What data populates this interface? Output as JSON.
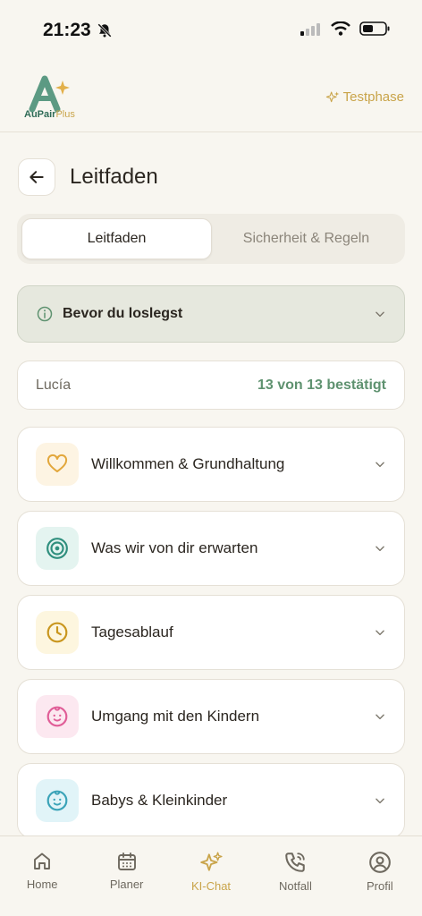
{
  "status": {
    "time": "21:23"
  },
  "header": {
    "logo_text_main": "AuPair",
    "logo_text_accent": "Plus",
    "trial_label": "Testphase"
  },
  "page": {
    "title": "Leitfaden"
  },
  "tabs": [
    {
      "label": "Leitfaden",
      "active": true
    },
    {
      "label": "Sicherheit & Regeln",
      "active": false
    }
  ],
  "notice": {
    "label": "Bevor du loslegst"
  },
  "progress": {
    "name": "Lucía",
    "status": "13 von 13 bestätigt"
  },
  "sections": [
    {
      "label": "Willkommen & Grundhaltung",
      "icon": "heart-icon",
      "color": "#e2a73c",
      "bg": "#fdf4e3"
    },
    {
      "label": "Was wir von dir erwarten",
      "icon": "target-icon",
      "color": "#2f8f7e",
      "bg": "#e4f4f0"
    },
    {
      "label": "Tagesablauf",
      "icon": "clock-icon",
      "color": "#c9961e",
      "bg": "#fdf6df"
    },
    {
      "label": "Umgang mit den Kindern",
      "icon": "baby-icon",
      "color": "#e05d97",
      "bg": "#fce8f0"
    },
    {
      "label": "Babys & Kleinkinder",
      "icon": "baby-icon",
      "color": "#3aa3b8",
      "bg": "#e1f4f8"
    }
  ],
  "nav": [
    {
      "label": "Home",
      "icon": "home-icon",
      "active": false
    },
    {
      "label": "Planer",
      "icon": "calendar-icon",
      "active": false
    },
    {
      "label": "KI-Chat",
      "icon": "sparkle-icon",
      "active": true
    },
    {
      "label": "Notfall",
      "icon": "phone-icon",
      "active": false
    },
    {
      "label": "Profil",
      "icon": "profile-icon",
      "active": false
    }
  ],
  "colors": {
    "accent": "#c9a44a",
    "brand": "#2f6b57",
    "success": "#5f9270",
    "background": "#f8f6f0"
  }
}
